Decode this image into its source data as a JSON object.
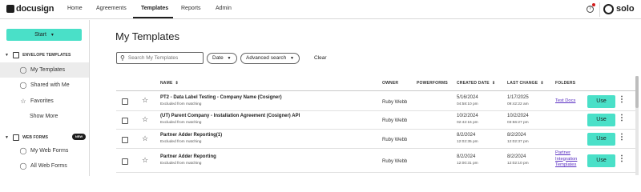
{
  "nav": {
    "logo": "docusign",
    "items": [
      "Home",
      "Agreements",
      "Templates",
      "Reports",
      "Admin"
    ],
    "active": "Templates",
    "help_icon": "help-circle-icon",
    "brand": "solo"
  },
  "sidebar": {
    "start_label": "Start",
    "start_caret": "▾",
    "envelope_section": "ENVELOPE TEMPLATES",
    "envelope_items": [
      {
        "label": "My Templates",
        "icon": "user-icon",
        "glyph": "👤"
      },
      {
        "label": "Shared with Me",
        "icon": "users-icon",
        "glyph": "👥"
      },
      {
        "label": "Favorites",
        "icon": "star-icon",
        "glyph": "☆"
      }
    ],
    "show_more": "Show More",
    "webforms_section": "WEB FORMS",
    "new_badge": "NEW",
    "webform_items": [
      {
        "label": "My Web Forms",
        "icon": "user-icon",
        "glyph": "👤"
      },
      {
        "label": "All Web Forms",
        "icon": "users-icon",
        "glyph": "👥"
      }
    ]
  },
  "main": {
    "title": "My Templates",
    "search_placeholder": "Search My Templates",
    "date_filter": "Date",
    "advanced_search": "Advanced search",
    "clear": "Clear"
  },
  "table": {
    "headers": {
      "name": "NAME",
      "owner": "OWNER",
      "powerforms": "POWERFORMS",
      "created": "CREATED DATE",
      "last_change": "LAST CHANGE",
      "folders": "FOLDERS"
    },
    "use_label": "Use",
    "rows": [
      {
        "name": "PT2 - Data Label Testing - Company Name (Cosigner)",
        "sub": "Excluded from matching",
        "owner": "Ruby Webb",
        "created_date": "5/16/2024",
        "created_time": "04:58:10 pm",
        "change_date": "1/17/2025",
        "change_time": "09:42:22 am",
        "folder": "Test Docs"
      },
      {
        "name": "(UT) Parent Company - Installation Agreement (Cosigner) API",
        "sub": "Excluded from matching",
        "owner": "Ruby Webb",
        "created_date": "10/2/2024",
        "created_time": "02:42:16 pm",
        "change_date": "10/2/2024",
        "change_time": "03:56:27 pm",
        "folder": ""
      },
      {
        "name": "Partner Adder Reporting(1)",
        "sub": "Excluded from matching",
        "owner": "Ruby Webb",
        "created_date": "8/2/2024",
        "created_time": "12:02:35 pm",
        "change_date": "8/2/2024",
        "change_time": "12:02:37 pm",
        "folder": ""
      },
      {
        "name": "Partner Adder Reporting",
        "sub": "Excluded from matching",
        "owner": "Ruby Webb",
        "created_date": "8/2/2024",
        "created_time": "12:00:31 pm",
        "change_date": "8/2/2024",
        "change_time": "12:02:10 pm",
        "folder": "Partner Integration Templates"
      }
    ]
  }
}
